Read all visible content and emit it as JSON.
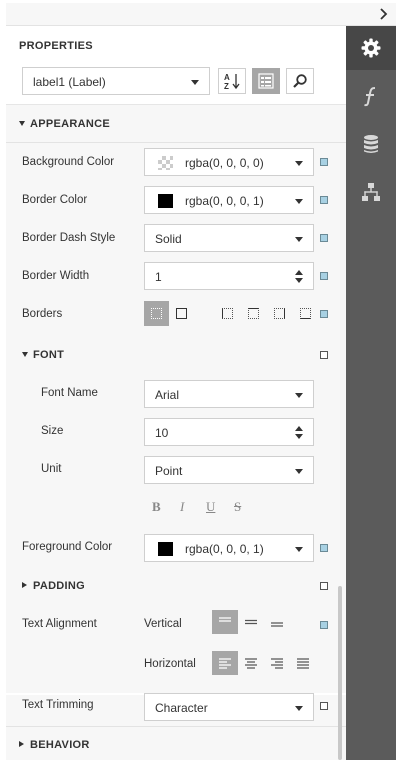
{
  "panel": {
    "title": "PROPERTIES",
    "selector_value": "label1 (Label)"
  },
  "sections": {
    "appearance": "APPEARANCE",
    "font": "FONT",
    "padding": "PADDING",
    "behavior": "BEHAVIOR"
  },
  "props": {
    "background_color": {
      "label": "Background Color",
      "value": "rgba(0, 0, 0, 0)"
    },
    "border_color": {
      "label": "Border Color",
      "value": "rgba(0, 0, 0, 1)"
    },
    "border_dash_style": {
      "label": "Border Dash Style",
      "value": "Solid"
    },
    "border_width": {
      "label": "Border Width",
      "value": "1"
    },
    "borders": {
      "label": "Borders"
    },
    "font_name": {
      "label": "Font Name",
      "value": "Arial"
    },
    "size": {
      "label": "Size",
      "value": "10"
    },
    "unit": {
      "label": "Unit",
      "value": "Point"
    },
    "foreground_color": {
      "label": "Foreground Color",
      "value": "rgba(0, 0, 0, 1)"
    },
    "text_alignment": {
      "label": "Text Alignment",
      "vertical": "Vertical",
      "horizontal": "Horizontal"
    },
    "text_trimming": {
      "label": "Text Trimming",
      "value": "Character"
    }
  },
  "format": {
    "bold": "B",
    "italic": "I",
    "underline": "U",
    "strike": "S"
  },
  "icons": {
    "collapse": "chevron-right-icon",
    "sort": "sort-alpha-icon",
    "categories": "categories-icon",
    "search": "search-icon",
    "properties_tab": "gear-icon",
    "expressions_tab": "function-icon",
    "data_tab": "database-icon",
    "structure_tab": "hierarchy-icon"
  },
  "colors": {
    "sidebar": "#5b5b5b",
    "sidebar_active": "#474747",
    "panel_bg": "#f7f7f7",
    "toggled": "#a6a6a6",
    "marker": "#a8d1e3"
  }
}
